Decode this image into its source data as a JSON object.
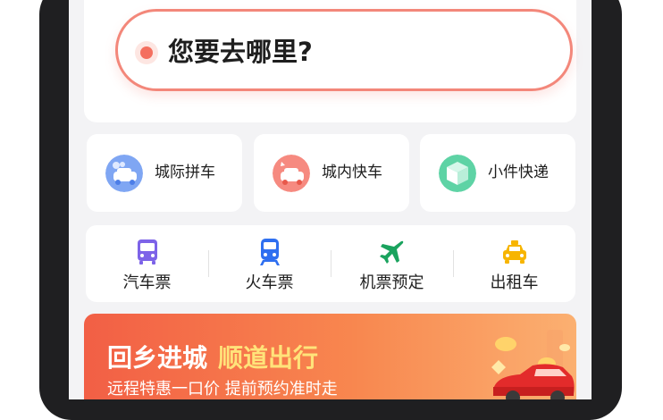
{
  "search": {
    "placeholder": "您要去哪里?"
  },
  "services": [
    {
      "label": "城际拼车",
      "icon": "carpool-icon"
    },
    {
      "label": "城内快车",
      "icon": "express-car-icon"
    },
    {
      "label": "小件快递",
      "icon": "package-icon"
    }
  ],
  "transport": [
    {
      "label": "汽车票",
      "icon": "bus-icon"
    },
    {
      "label": "火车票",
      "icon": "train-icon"
    },
    {
      "label": "机票预定",
      "icon": "airplane-icon"
    },
    {
      "label": "出租车",
      "icon": "taxi-icon"
    }
  ],
  "promo": {
    "title": "回乡进城",
    "title_accent": "顺道出行",
    "subtitle": "远程特惠一口价  提前预约准时走"
  },
  "colors": {
    "accent": "#f46f5f",
    "banner_start": "#f25f45",
    "banner_end": "#fbb071",
    "highlight": "#ffe37a"
  }
}
